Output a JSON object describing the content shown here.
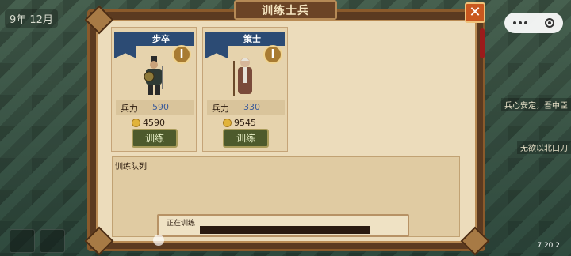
{
  "hud": {
    "date": "9年 12月"
  },
  "panel": {
    "title": "训练士兵"
  },
  "units": [
    {
      "name": "步卒",
      "stat_label": "兵力",
      "stat_value": "590",
      "cost": "4590",
      "train_label": "训练",
      "portrait_icon": "armored-soldier"
    },
    {
      "name": "策士",
      "stat_label": "兵力",
      "stat_value": "330",
      "cost": "9545",
      "train_label": "训练",
      "portrait_icon": "elder-strategist"
    }
  ],
  "queue": {
    "title": "训练队列",
    "status_label": "正在训练",
    "progress": 0
  },
  "side_texts": [
    "兵心安定，吾中臣",
    "无欲以北口刀"
  ],
  "fps": "7 20 2",
  "colors": {
    "accent_banner": "#2c4b74",
    "frame": "#5b3a20",
    "close": "#c9581f"
  }
}
